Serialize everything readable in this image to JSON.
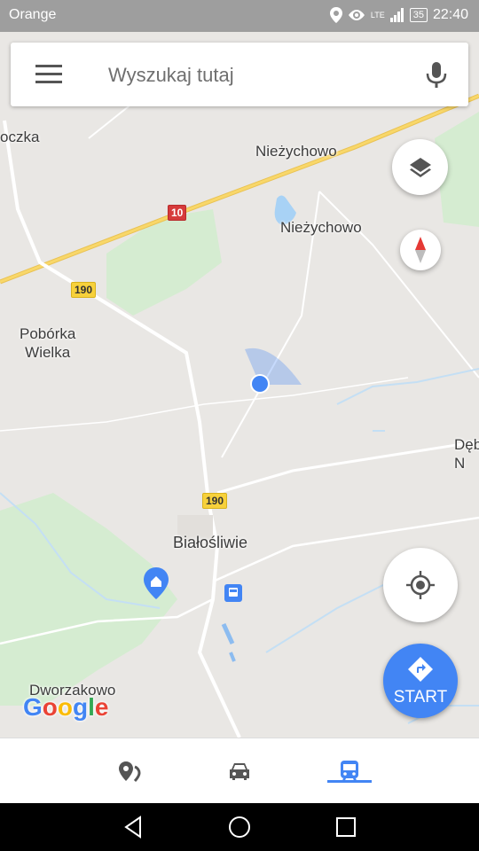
{
  "status_bar": {
    "carrier": "Orange",
    "network": "LTE",
    "battery": "35",
    "time": "22:40",
    "icons": [
      "location-icon",
      "eye-icon",
      "signal-icon"
    ]
  },
  "search": {
    "placeholder": "Wyszukaj tutaj",
    "menu_icon": "hamburger-menu-icon",
    "voice_icon": "microphone-icon"
  },
  "map": {
    "places": {
      "oczka": "oczka",
      "niezychowo_village": "Nieżychowo",
      "niezychowo_lake": "Nieżychowo",
      "poborka": "Pobórka\nWielka",
      "debn": "Dęb\nN",
      "bialosliwie": "Białośliwie",
      "dworzakowo": "Dworzakowo"
    },
    "roads": {
      "route_10": "10",
      "route_190_north": "190",
      "route_190_south": "190"
    },
    "colors": {
      "background": "#e9e7e4",
      "forest": "#d5ecd1",
      "highway": "#f8d76a",
      "water": "#a8d2f5",
      "location": "#4285f4"
    }
  },
  "controls": {
    "layers_icon": "layers-icon",
    "compass_icon": "compass-icon",
    "my_location_icon": "my-location-icon",
    "start_label": "START",
    "start_icon": "directions-icon"
  },
  "branding": {
    "logo": "Google"
  },
  "bottom_nav": {
    "tabs": [
      {
        "icon": "explore-places-icon",
        "active": false
      },
      {
        "icon": "driving-car-icon",
        "active": false
      },
      {
        "icon": "transit-bus-icon",
        "active": true
      }
    ]
  },
  "android_nav": {
    "buttons": [
      "back-icon",
      "home-icon",
      "recents-icon"
    ]
  }
}
